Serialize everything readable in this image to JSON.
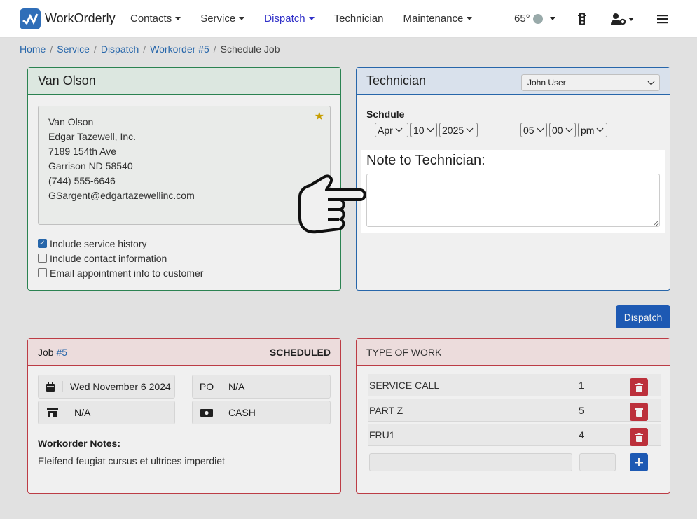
{
  "app": {
    "name": "WorkOrderly"
  },
  "nav": {
    "items": [
      {
        "label": "Contacts",
        "caret": true
      },
      {
        "label": "Service",
        "caret": true
      },
      {
        "label": "Dispatch",
        "caret": true
      },
      {
        "label": "Technician",
        "caret": false
      },
      {
        "label": "Maintenance",
        "caret": true
      }
    ],
    "temperature": "65°",
    "active_color": "#3030c8"
  },
  "breadcrumb": [
    "Home",
    "Service",
    "Dispatch",
    "Workorder #5",
    "Schedule Job"
  ],
  "customer_panel": {
    "title": "Van Olson",
    "address": [
      "Van Olson",
      "Edgar Tazewell, Inc.",
      "7189 154th Ave",
      "Garrison ND 58540",
      "(744) 555-6646",
      "GSargent@edgartazewellinc.com"
    ],
    "options": [
      {
        "label": "Include service history",
        "checked": true
      },
      {
        "label": "Include contact information",
        "checked": false
      },
      {
        "label": "Email appointment info to customer",
        "checked": false
      }
    ]
  },
  "tech_panel": {
    "title": "Technician",
    "technician_select": "John User",
    "schedule_label": "Schdule",
    "month": "Apr",
    "day": "10",
    "year": "2025",
    "hour": "05",
    "minute": "00",
    "ampm": "pm",
    "note_label": "Note to Technician:",
    "note_value": ""
  },
  "dispatch_button": "Dispatch",
  "job_panel": {
    "job_label": "Job",
    "job_number": "#5",
    "status": "SCHEDULED",
    "date": "Wed November 6 2024",
    "po_label": "PO",
    "po_value": "N/A",
    "store_value": "N/A",
    "payment": "CASH",
    "notes_label": "Workorder Notes:",
    "notes": "Eleifend feugiat cursus et ultrices imperdiet"
  },
  "work_panel": {
    "title": "TYPE OF WORK",
    "rows": [
      {
        "name": "SERVICE CALL",
        "qty": "1"
      },
      {
        "name": "PART Z",
        "qty": "5"
      },
      {
        "name": "FRU1",
        "qty": "4"
      }
    ],
    "add_icon": "plus-icon"
  },
  "colors": {
    "green": "#2e8b57",
    "blue": "#2a6db5",
    "red": "#c8404a",
    "primary": "#1f5fbf"
  }
}
